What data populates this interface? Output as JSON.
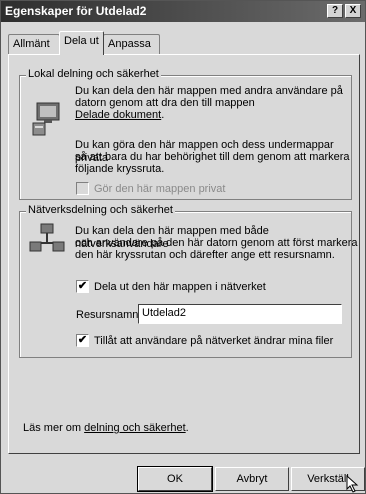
{
  "window": {
    "title": "Egenskaper för Utdelad2",
    "help_btn": "?",
    "close_btn": "X"
  },
  "tabs": [
    {
      "label": "Allmänt"
    },
    {
      "label": "Dela ut"
    },
    {
      "label": "Anpassa"
    }
  ],
  "local_group": {
    "title": "Lokal delning och säkerhet",
    "line1": "Du kan dela den här mappen med andra användare på",
    "line2": "datorn genom att dra den till mappen",
    "link": "Delade dokument",
    "link_suffix": ".",
    "para2_line1": "Du kan göra den här mappen och dess undermappar privata",
    "para2_line2": "så att bara du har behörighet till dem genom att markera",
    "para2_line3": "följande kryssruta.",
    "private_checkbox": "Gör den här mappen privat"
  },
  "network_group": {
    "title": "Nätverksdelning och säkerhet",
    "line1": "Du kan dela den här mappen med både nätverksanvändare",
    "line2": "och användare på den här datorn genom att först markera",
    "line3": "den här kryssrutan och därefter ange ett resursnamn.",
    "share_checkbox": "Dela ut den här mappen i nätverket",
    "share_name_label": "Resursnamn:",
    "share_name_value": "Utdelad2",
    "allow_checkbox": "Tillåt att användare på nätverket ändrar mina filer",
    "check_mark": "✔"
  },
  "learn_more": {
    "prefix": "Läs mer om ",
    "link": "delning och säkerhet",
    "suffix": "."
  },
  "buttons": {
    "ok": "OK",
    "cancel": "Avbryt",
    "apply": "Verkställ"
  }
}
